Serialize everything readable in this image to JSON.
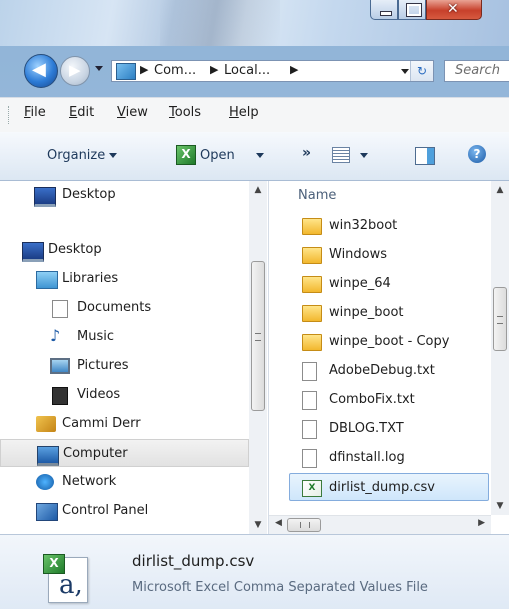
{
  "address": {
    "crumbs": [
      "Com...",
      "Local..."
    ],
    "search_placeholder": "Search"
  },
  "menu": {
    "file": "File",
    "edit": "Edit",
    "view": "View",
    "tools": "Tools",
    "help": "Help"
  },
  "commands": {
    "organize": "Organize",
    "open": "Open",
    "more": "»"
  },
  "nav": {
    "items": [
      {
        "label": "Desktop",
        "icon": "desktop-icon"
      },
      {
        "label": "Desktop",
        "icon": "desktop-icon"
      },
      {
        "label": "Libraries",
        "icon": "libraries-icon"
      },
      {
        "label": "Documents",
        "icon": "documents-icon"
      },
      {
        "label": "Music",
        "icon": "music-icon"
      },
      {
        "label": "Pictures",
        "icon": "pictures-icon"
      },
      {
        "label": "Videos",
        "icon": "videos-icon"
      },
      {
        "label": "Cammi Derr",
        "icon": "user-folder-icon"
      },
      {
        "label": "Computer",
        "icon": "computer-icon",
        "selected": true
      },
      {
        "label": "Network",
        "icon": "network-icon"
      },
      {
        "label": "Control Panel",
        "icon": "control-panel-icon"
      }
    ]
  },
  "files": {
    "column_name": "Name",
    "items": [
      {
        "label": "win32boot",
        "icon": "folder-icon"
      },
      {
        "label": "Windows",
        "icon": "folder-icon"
      },
      {
        "label": "winpe_64",
        "icon": "folder-icon"
      },
      {
        "label": "winpe_boot",
        "icon": "folder-icon"
      },
      {
        "label": "winpe_boot - Copy",
        "icon": "folder-icon"
      },
      {
        "label": "AdobeDebug.txt",
        "icon": "text-file-icon"
      },
      {
        "label": "ComboFix.txt",
        "icon": "text-file-icon"
      },
      {
        "label": "DBLOG.TXT",
        "icon": "text-file-icon"
      },
      {
        "label": "dfinstall.log",
        "icon": "text-file-icon"
      },
      {
        "label": "dirlist_dump.csv",
        "icon": "csv-file-icon",
        "selected": true
      }
    ]
  },
  "details": {
    "filename": "dirlist_dump.csv",
    "filetype": "Microsoft Excel Comma Separated Values File"
  },
  "colors": {
    "selection_blue": "#cfe6fb",
    "close_red": "#c7402b",
    "accent_blue": "#1e395b"
  }
}
